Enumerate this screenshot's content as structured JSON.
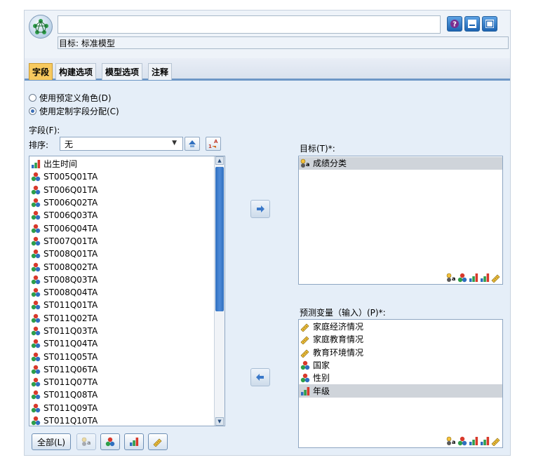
{
  "window": {
    "name_value": "",
    "target_label": "目标: 标准模型",
    "buttons": [
      "help-icon",
      "minimize-icon",
      "maximize-icon"
    ]
  },
  "tabs": [
    {
      "label": "字段",
      "active": true
    },
    {
      "label": "构建选项",
      "active": false
    },
    {
      "label": "模型选项",
      "active": false
    },
    {
      "label": "注释",
      "active": false
    }
  ],
  "roles": {
    "option1": "使用预定义角色(D)",
    "option2": "使用定制字段分配(C)",
    "selected": 2
  },
  "fields": {
    "label": "字段(F):",
    "sort_label": "排序:",
    "sort_value": "无",
    "items": [
      {
        "name": "出生时间",
        "type": "ordinal"
      },
      {
        "name": "ST005Q01TA",
        "type": "nominal"
      },
      {
        "name": "ST006Q01TA",
        "type": "nominal"
      },
      {
        "name": "ST006Q02TA",
        "type": "nominal"
      },
      {
        "name": "ST006Q03TA",
        "type": "nominal"
      },
      {
        "name": "ST006Q04TA",
        "type": "nominal"
      },
      {
        "name": "ST007Q01TA",
        "type": "nominal"
      },
      {
        "name": "ST008Q01TA",
        "type": "nominal"
      },
      {
        "name": "ST008Q02TA",
        "type": "nominal"
      },
      {
        "name": "ST008Q03TA",
        "type": "nominal"
      },
      {
        "name": "ST008Q04TA",
        "type": "nominal"
      },
      {
        "name": "ST011Q01TA",
        "type": "nominal"
      },
      {
        "name": "ST011Q02TA",
        "type": "nominal"
      },
      {
        "name": "ST011Q03TA",
        "type": "nominal"
      },
      {
        "name": "ST011Q04TA",
        "type": "nominal"
      },
      {
        "name": "ST011Q05TA",
        "type": "nominal"
      },
      {
        "name": "ST011Q06TA",
        "type": "nominal"
      },
      {
        "name": "ST011Q07TA",
        "type": "nominal"
      },
      {
        "name": "ST011Q08TA",
        "type": "nominal"
      },
      {
        "name": "ST011Q09TA",
        "type": "nominal"
      },
      {
        "name": "ST011Q10TA",
        "type": "nominal"
      }
    ],
    "all_button": "全部(L)"
  },
  "target": {
    "label": "目标(T)*:",
    "items": [
      {
        "name": "成绩分类",
        "type": "flag"
      }
    ]
  },
  "predictors": {
    "label": "预测变量（输入）(P)*:",
    "items": [
      {
        "name": "家庭经济情况",
        "type": "continuous"
      },
      {
        "name": "家庭教育情况",
        "type": "continuous"
      },
      {
        "name": "教育环境情况",
        "type": "continuous"
      },
      {
        "name": "国家",
        "type": "nominal"
      },
      {
        "name": "性别",
        "type": "nominal"
      },
      {
        "name": "年级",
        "type": "ordinal"
      }
    ],
    "selected_index": 5
  },
  "colors": {
    "accent": "#2f6fbf",
    "tab_active": "#f7c95e",
    "selection": "#cfd4da"
  }
}
